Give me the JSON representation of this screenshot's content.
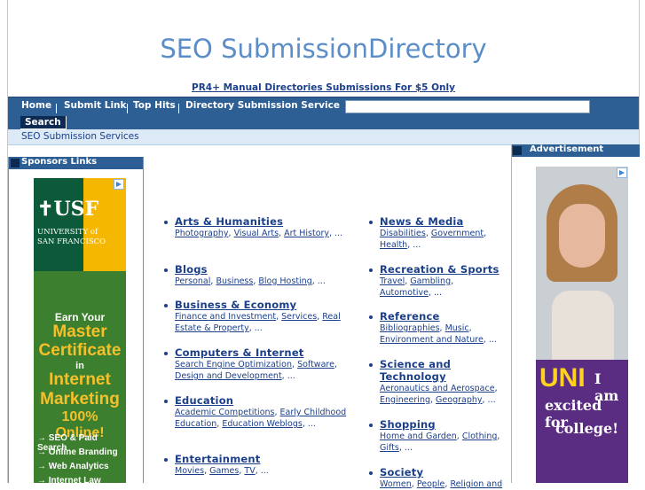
{
  "header": {
    "logo_text": "SEO SubmissionDirectory",
    "promo_link": "PR4+ Manual Directories Submissions For $5 Only"
  },
  "nav": {
    "items": [
      "Home",
      "Submit Link",
      "Top Hits",
      "Directory Submission Service"
    ],
    "search_value": "",
    "search_button": "Search"
  },
  "subnav": {
    "link": "SEO Submission Services"
  },
  "left_sidebar": {
    "heading": "Sponsors Links",
    "ad": {
      "brand": "USF",
      "brand_sub": [
        "UNIVERSITY of",
        "SAN FRANCISCO"
      ],
      "lines": [
        "Earn Your",
        "Master",
        "Certificate",
        "in",
        "Internet",
        "Marketing",
        "100% Online!",
        "→ SEO & Paid Search",
        "→ Online Branding",
        "→ Web Analytics",
        "→ Internet Law"
      ]
    }
  },
  "right_sidebar": {
    "heading": "Advertisement",
    "ad": {
      "big": "UNI",
      "lines": [
        "I am",
        "excited for",
        "college!"
      ]
    }
  },
  "categories": {
    "left": [
      {
        "title": "Arts & Humanities",
        "subs": [
          "Photography",
          "Visual Arts",
          "Art History"
        ],
        "more": "..."
      },
      {
        "title": "Blogs",
        "subs": [
          "Personal",
          "Business",
          "Blog Hosting"
        ],
        "more": "..."
      },
      {
        "title": "Business & Economy",
        "subs": [
          "Finance and Investment",
          "Services",
          "Real Estate & Property"
        ],
        "more": "..."
      },
      {
        "title": "Computers & Internet",
        "subs": [
          "Search Engine Optimization",
          "Software",
          "Design and Development"
        ],
        "more": "..."
      },
      {
        "title": "Education",
        "subs": [
          "Academic Competitions",
          "Early Childhood Education",
          "Education Weblogs"
        ],
        "more": "..."
      },
      {
        "title": "Entertainment",
        "subs": [
          "Movies",
          "Games",
          "TV"
        ],
        "more": "..."
      }
    ],
    "right": [
      {
        "title": "News & Media",
        "subs": [
          "Disabilities",
          "Government",
          "Health"
        ],
        "more": "..."
      },
      {
        "title": "Recreation & Sports",
        "subs": [
          "Travel",
          "Gambling",
          "Automotive"
        ],
        "more": "..."
      },
      {
        "title": "Reference",
        "subs": [
          "Bibliographies",
          "Music",
          "Environment and Nature"
        ],
        "more": "..."
      },
      {
        "title": "Science and Technology",
        "subs": [
          "Aeronautics and Aerospace",
          "Engineering",
          "Geography"
        ],
        "more": "..."
      },
      {
        "title": "Shopping",
        "subs": [
          "Home and Garden",
          "Clothing",
          "Gifts"
        ],
        "more": "..."
      },
      {
        "title": "Society",
        "subs": [
          "Women",
          "People",
          "Religion and"
        ],
        "more": ""
      }
    ]
  }
}
